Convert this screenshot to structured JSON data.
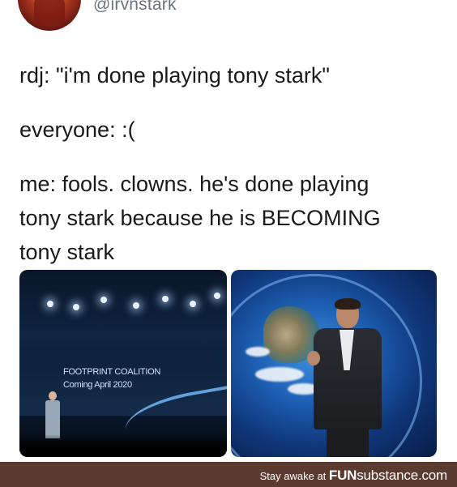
{
  "author": {
    "handle": "@irvnstark"
  },
  "tweet": {
    "lines": [
      "rdj: \"i'm done playing tony stark\"",
      "everyone: :(",
      "me: fools. clowns. he's done playing",
      "tony stark because he is BECOMING",
      "tony stark"
    ]
  },
  "photos": {
    "left": {
      "screen_line1": "FOOTPRINT COALITION",
      "screen_line2": "Coming April 2020"
    }
  },
  "footer": {
    "prefix": "Stay awake at ",
    "brand_bold": "FUN",
    "brand_rest": "substance.com"
  }
}
